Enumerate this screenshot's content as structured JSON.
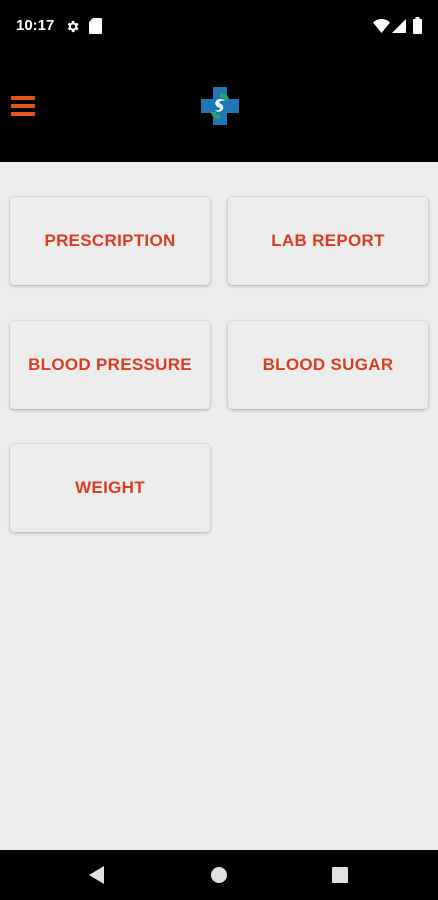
{
  "status_bar": {
    "time": "10:17",
    "icons_left": [
      "settings-icon",
      "sd-card-icon"
    ],
    "icons_right": [
      "wifi-icon",
      "cell-signal-icon",
      "battery-icon"
    ]
  },
  "app_bar": {
    "menu_icon": "hamburger-menu-icon",
    "logo_icon": "medical-cross-logo",
    "accent_color": "#e8531c"
  },
  "menu": {
    "items": [
      {
        "id": "prescription",
        "label": "PRESCRIPTION"
      },
      {
        "id": "lab-report",
        "label": "LAB REPORT"
      },
      {
        "id": "blood-pressure",
        "label": "BLOOD PRESSURE"
      },
      {
        "id": "blood-sugar",
        "label": "BLOOD SUGAR"
      },
      {
        "id": "weight",
        "label": "WEIGHT"
      }
    ],
    "label_color": "#dc3d1f"
  },
  "nav_bar": {
    "buttons": [
      "back-icon",
      "home-icon",
      "recents-icon"
    ]
  }
}
